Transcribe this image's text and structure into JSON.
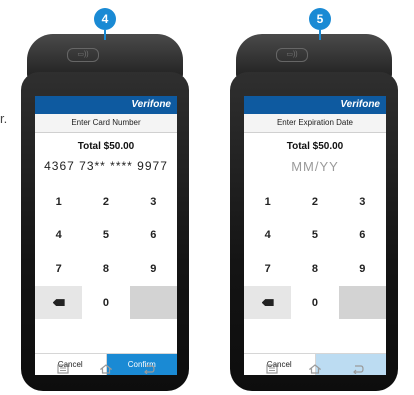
{
  "stray_char": "r.",
  "steps": [
    {
      "badge": "4",
      "device": {
        "reader_icon": "card-reader-slot-icon",
        "brand": "Verifone",
        "prompt": "Enter Card Number",
        "total": "Total $50.00",
        "entry": "4367 73** **** 9977",
        "entry_is_placeholder": false,
        "keys": [
          "1",
          "2",
          "3",
          "4",
          "5",
          "6",
          "7",
          "8",
          "9",
          "",
          "0",
          ""
        ],
        "cancel_label": "Cancel",
        "confirm_label": "Confirm",
        "confirm_enabled": true
      }
    },
    {
      "badge": "5",
      "device": {
        "reader_icon": "card-reader-slot-icon",
        "brand": "Verifone",
        "prompt": "Enter Expiration Date",
        "total": "Total $50.00",
        "entry": "MM/YY",
        "entry_is_placeholder": true,
        "keys": [
          "1",
          "2",
          "3",
          "4",
          "5",
          "6",
          "7",
          "8",
          "9",
          "",
          "0",
          ""
        ],
        "cancel_label": "Cancel",
        "confirm_label": "",
        "confirm_enabled": false
      }
    }
  ],
  "nav_icons": [
    "menu-icon",
    "home-icon",
    "back-icon"
  ],
  "colors": {
    "accent": "#1a8ad4",
    "brand_bar": "#0e5aa0",
    "device_body": "#1e1e1e"
  }
}
